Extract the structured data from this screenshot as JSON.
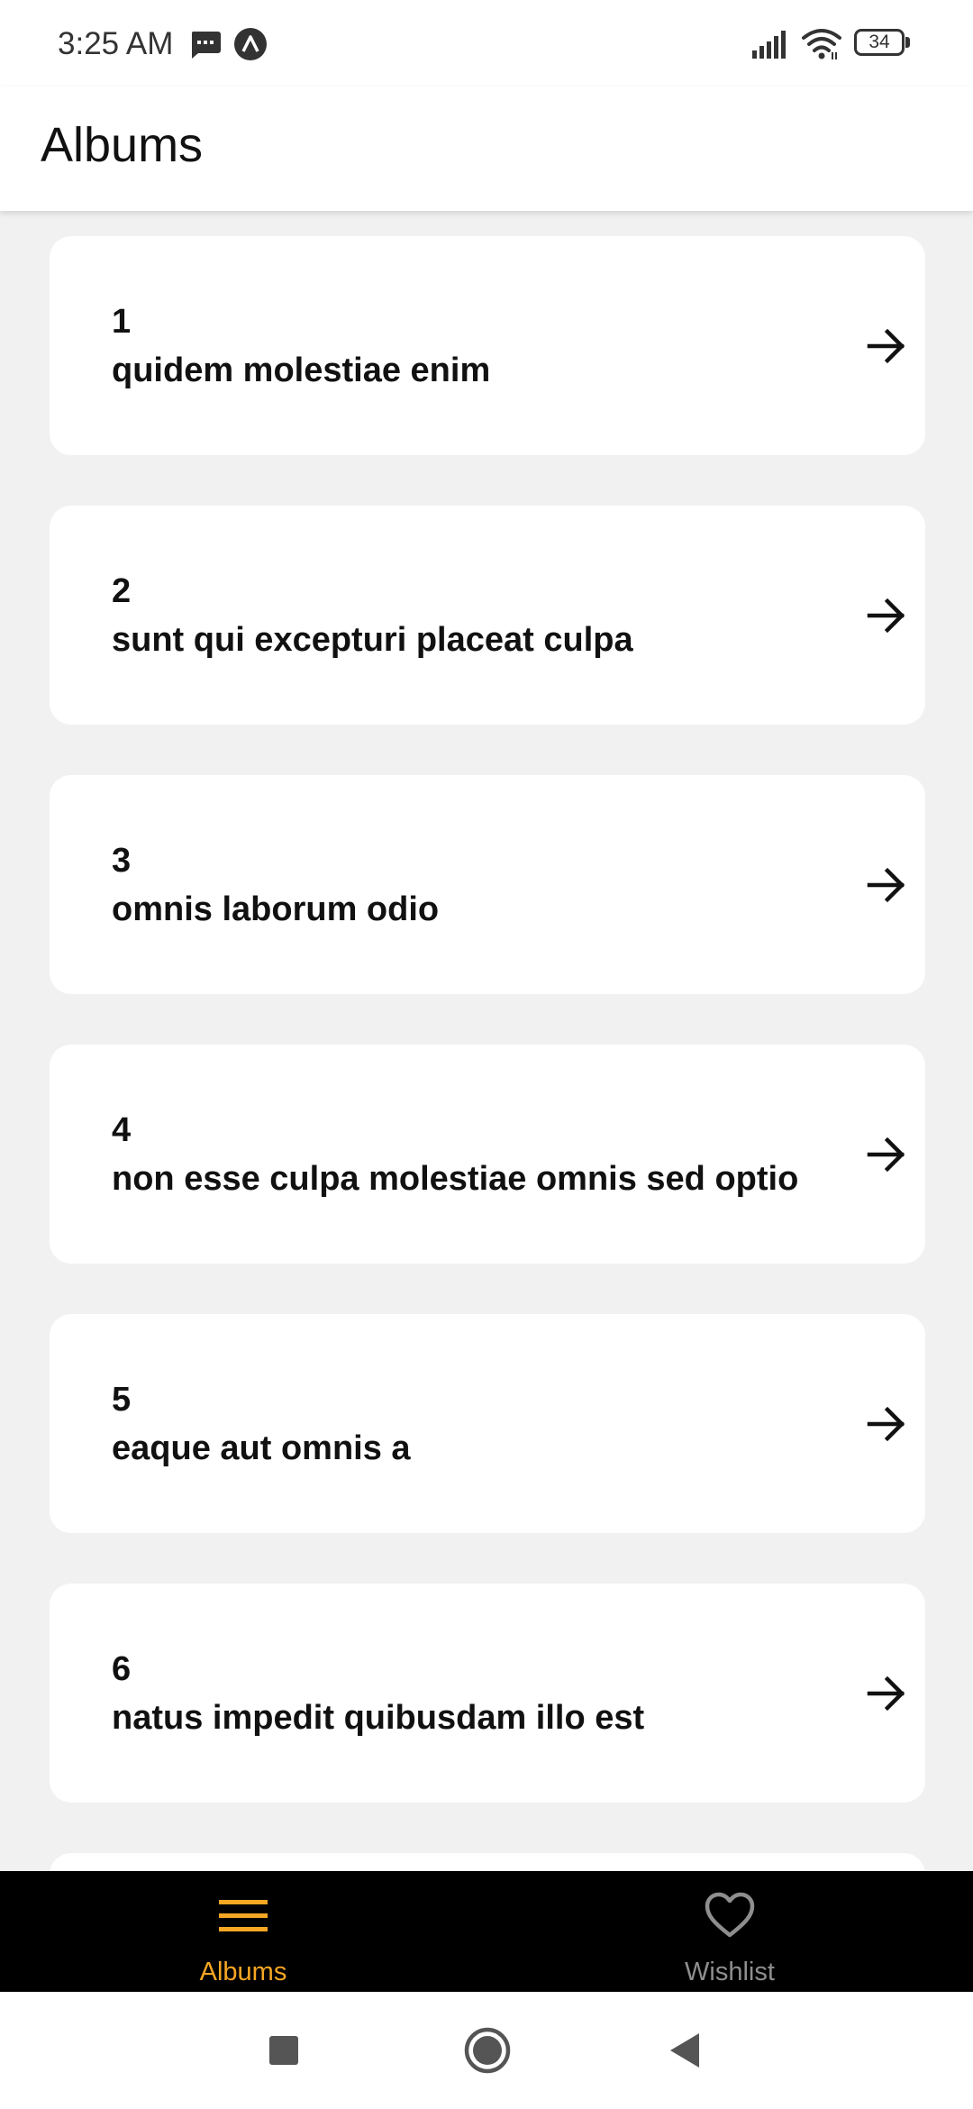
{
  "status_bar": {
    "time": "3:25 AM",
    "battery": "34",
    "icons": [
      "message-icon",
      "app-notification-icon",
      "signal-icon",
      "wifi-icon",
      "battery-icon"
    ]
  },
  "header": {
    "title": "Albums"
  },
  "albums": [
    {
      "id": "1",
      "title": "quidem molestiae enim"
    },
    {
      "id": "2",
      "title": "sunt qui excepturi placeat culpa"
    },
    {
      "id": "3",
      "title": "omnis laborum odio"
    },
    {
      "id": "4",
      "title": "non esse culpa molestiae omnis sed optio"
    },
    {
      "id": "5",
      "title": "eaque aut omnis a"
    },
    {
      "id": "6",
      "title": "natus impedit quibusdam illo est"
    }
  ],
  "bottom_nav": {
    "items": [
      {
        "label": "Albums",
        "icon": "menu-icon",
        "active": true
      },
      {
        "label": "Wishlist",
        "icon": "heart-icon",
        "active": false
      }
    ]
  },
  "colors": {
    "accent": "#f5a623",
    "inactive": "#8e8e8e",
    "nav_background": "#000000",
    "list_background": "#f1f1f1",
    "card_background": "#ffffff"
  },
  "system_nav": {
    "buttons": [
      "recents-button",
      "home-button",
      "back-button"
    ]
  }
}
